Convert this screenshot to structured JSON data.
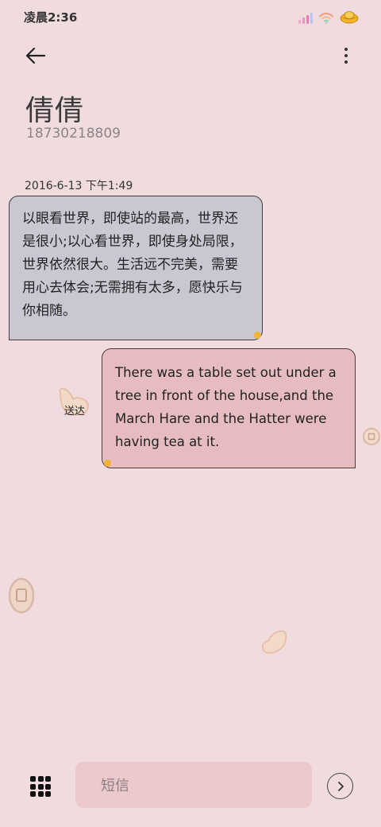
{
  "status_bar": {
    "time": "凌晨2:36",
    "icons": [
      "signal-icon",
      "wifi-icon",
      "battery-icon"
    ]
  },
  "header": {
    "back_icon": "back-arrow-icon",
    "menu_icon": "more-vertical-icon",
    "contact_name": "倩倩",
    "contact_number": "18730218809"
  },
  "conversation": {
    "timestamp": "2016-6-13 下午1:49",
    "messages": [
      {
        "direction": "incoming",
        "text": "以眼看世界，即使站的最高，世界还是很小;以心看世界，即使身处局限，世界依然很大。生活远不完美，需要用心去体会;无需拥有太多，愿快乐与你相随。"
      },
      {
        "direction": "outgoing",
        "text": "There was a table set out under a tree in front of the house,and the March Hare and the Hatter were having tea at it.",
        "status": "送达"
      }
    ]
  },
  "composer": {
    "apps_icon": "apps-grid-icon",
    "placeholder": "短信",
    "send_icon": "send-arrow-icon"
  },
  "colors": {
    "background": "#f0dcdf",
    "incoming_bubble": "#c7c8d2",
    "outgoing_bubble": "#e6bcc0",
    "input_background": "#ecc9cc"
  }
}
